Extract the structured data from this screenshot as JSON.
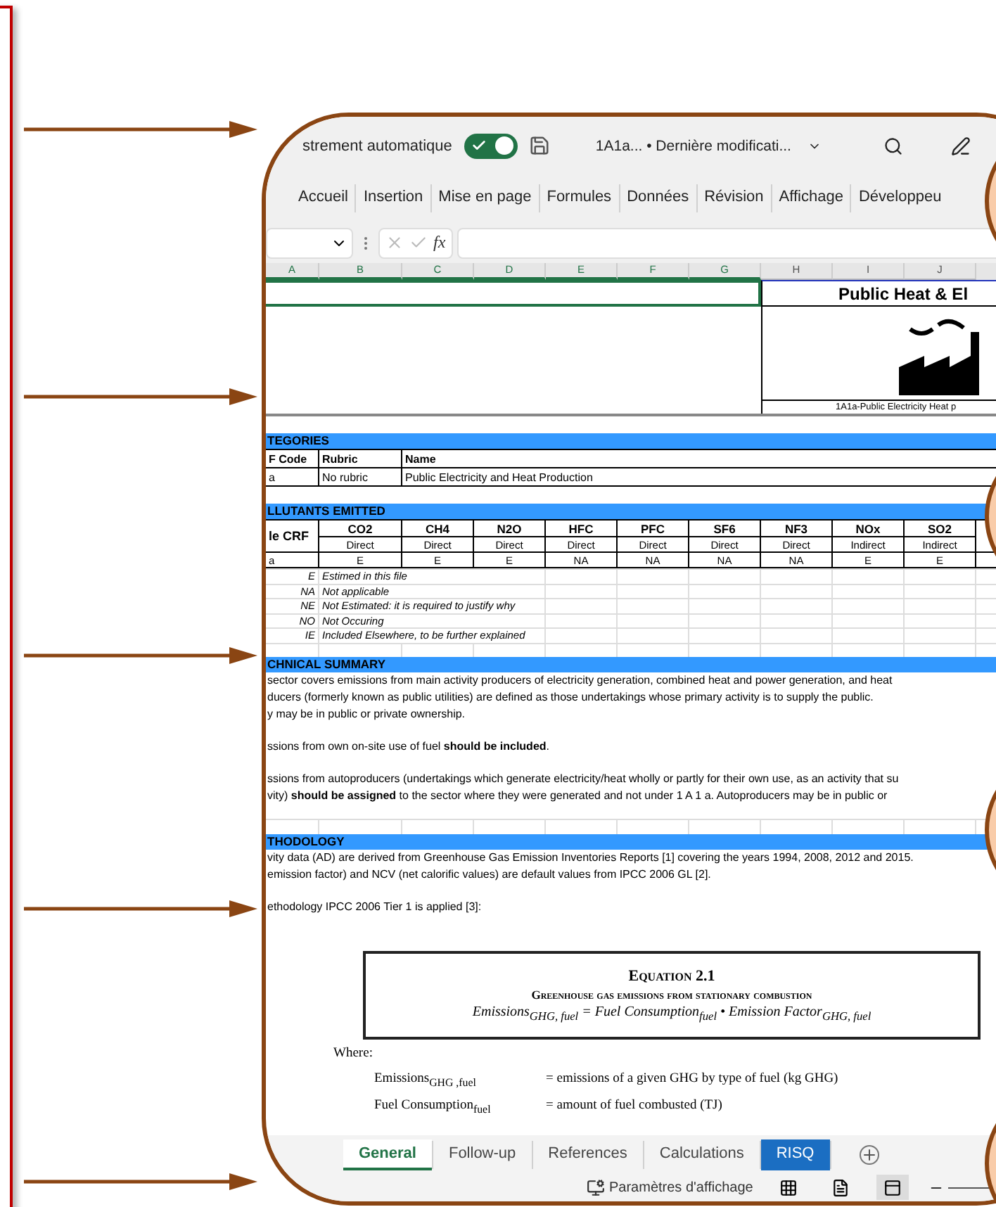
{
  "title_bar": {
    "autosave_label": "strement automatique",
    "autosave_on": true,
    "document_title": "1A1a...  • Dernière modificati..."
  },
  "ribbon_tabs": [
    {
      "label": "Accueil",
      "selected": false
    },
    {
      "label": "Insertion",
      "selected": false
    },
    {
      "label": "Mise en page",
      "selected": false
    },
    {
      "label": "Formules",
      "selected": false
    },
    {
      "label": "Données",
      "selected": false
    },
    {
      "label": "Révision",
      "selected": false
    },
    {
      "label": "Affichage",
      "selected": false
    },
    {
      "label": "Développeu",
      "selected": false
    }
  ],
  "formula_bar": {
    "function_label": "fx"
  },
  "columns": [
    {
      "label": "A",
      "selected": true
    },
    {
      "label": "B",
      "selected": true
    },
    {
      "label": "C",
      "selected": true
    },
    {
      "label": "D",
      "selected": true
    },
    {
      "label": "E",
      "selected": true
    },
    {
      "label": "F",
      "selected": true
    },
    {
      "label": "G",
      "selected": true
    },
    {
      "label": "H",
      "selected": false
    },
    {
      "label": "I",
      "selected": false
    },
    {
      "label": "J",
      "selected": false
    }
  ],
  "header": {
    "title": "Public Heat & El",
    "caption": "1A1a-Public Electricity Heat p"
  },
  "categories": {
    "title": "TEGORIES",
    "headers": [
      "F Code",
      "Rubric",
      "Name"
    ],
    "row": [
      "a",
      "No rubric",
      "Public Electricity and Heat Production"
    ]
  },
  "pollutants": {
    "title": "LLUTANTS EMITTED",
    "row_header": "le CRF",
    "row_code": "a",
    "gases": [
      {
        "name": "CO2",
        "type": "Direct",
        "value": "E"
      },
      {
        "name": "CH4",
        "type": "Direct",
        "value": "E"
      },
      {
        "name": "N2O",
        "type": "Direct",
        "value": "E"
      },
      {
        "name": "HFC",
        "type": "Direct",
        "value": "NA"
      },
      {
        "name": "PFC",
        "type": "Direct",
        "value": "NA"
      },
      {
        "name": "SF6",
        "type": "Direct",
        "value": "NA"
      },
      {
        "name": "NF3",
        "type": "Direct",
        "value": "NA"
      },
      {
        "name": "NOx",
        "type": "Indirect",
        "value": "E"
      },
      {
        "name": "SO2",
        "type": "Indirect",
        "value": "E"
      }
    ],
    "legend": [
      {
        "code": "E",
        "text": "Estimed in this file"
      },
      {
        "code": "NA",
        "text": "Not applicable"
      },
      {
        "code": "NE",
        "text": "Not Estimated: it is required to justify why"
      },
      {
        "code": "NO",
        "text": "Not Occuring"
      },
      {
        "code": "IE",
        "text": "Included Elsewhere, to be further explained"
      }
    ]
  },
  "technical_summary": {
    "title": "CHNICAL SUMMARY",
    "paragraphs": [
      [
        "sector covers emissions from main activity producers of electricity generation, combined heat and power generation, and heat",
        "ducers (formerly known as public utilities) are defined as those undertakings whose primary activity is to supply the public.",
        "y may be in public or private ownership."
      ],
      [
        "ssions from own on-site use of fuel **should be included**."
      ],
      [
        "ssions from autoproducers (undertakings which generate electricity/heat wholly or partly for their own use, as an activity that su",
        "vity) **should be assigned** to the sector where they were generated and not under 1 A 1 a. Autoproducers may be in public or"
      ]
    ]
  },
  "methodology": {
    "title": "THODOLOGY",
    "paragraphs": [
      [
        "vity data (AD) are derived from Greenhouse Gas Emission Inventories Reports [1] covering the years 1994, 2008, 2012 and 2015.",
        "emission factor) and NCV (net calorific values) are default values from IPCC 2006 GL [2]."
      ],
      [
        "ethodology IPCC 2006 Tier 1 is applied [3]:"
      ]
    ],
    "equation": {
      "title": "Equation 2.1",
      "subtitle": "Greenhouse gas emissions from stationary combustion",
      "formula": "Emissions$_{GHG, fuel}$ = Fuel  Consumption$_{fuel}$ • Emission  Factor$_{GHG, fuel}$"
    },
    "where": {
      "label": "Where:",
      "rows": [
        {
          "term": "Emissions$_{GHG ,fuel}$",
          "definition": "=  emissions of a given GHG by type of fuel (kg GHG)"
        },
        {
          "term": "Fuel Consumption$_{fuel}$",
          "definition": "=  amount of fuel combusted (TJ)"
        }
      ]
    }
  },
  "sheet_tabs": [
    {
      "label": "General",
      "selected": true
    },
    {
      "label": "Follow-up",
      "selected": false
    },
    {
      "label": "References",
      "selected": false
    },
    {
      "label": "Calculations",
      "selected": false
    },
    {
      "label": "RISQ",
      "selected": false,
      "color": "#1b6ec2"
    }
  ],
  "status_bar": {
    "display_settings": "Paramètres d'affichage",
    "views": [
      {
        "kind": "normal",
        "selected": false
      },
      {
        "kind": "page_layout",
        "selected": false
      },
      {
        "kind": "page_break",
        "selected": true
      }
    ]
  }
}
